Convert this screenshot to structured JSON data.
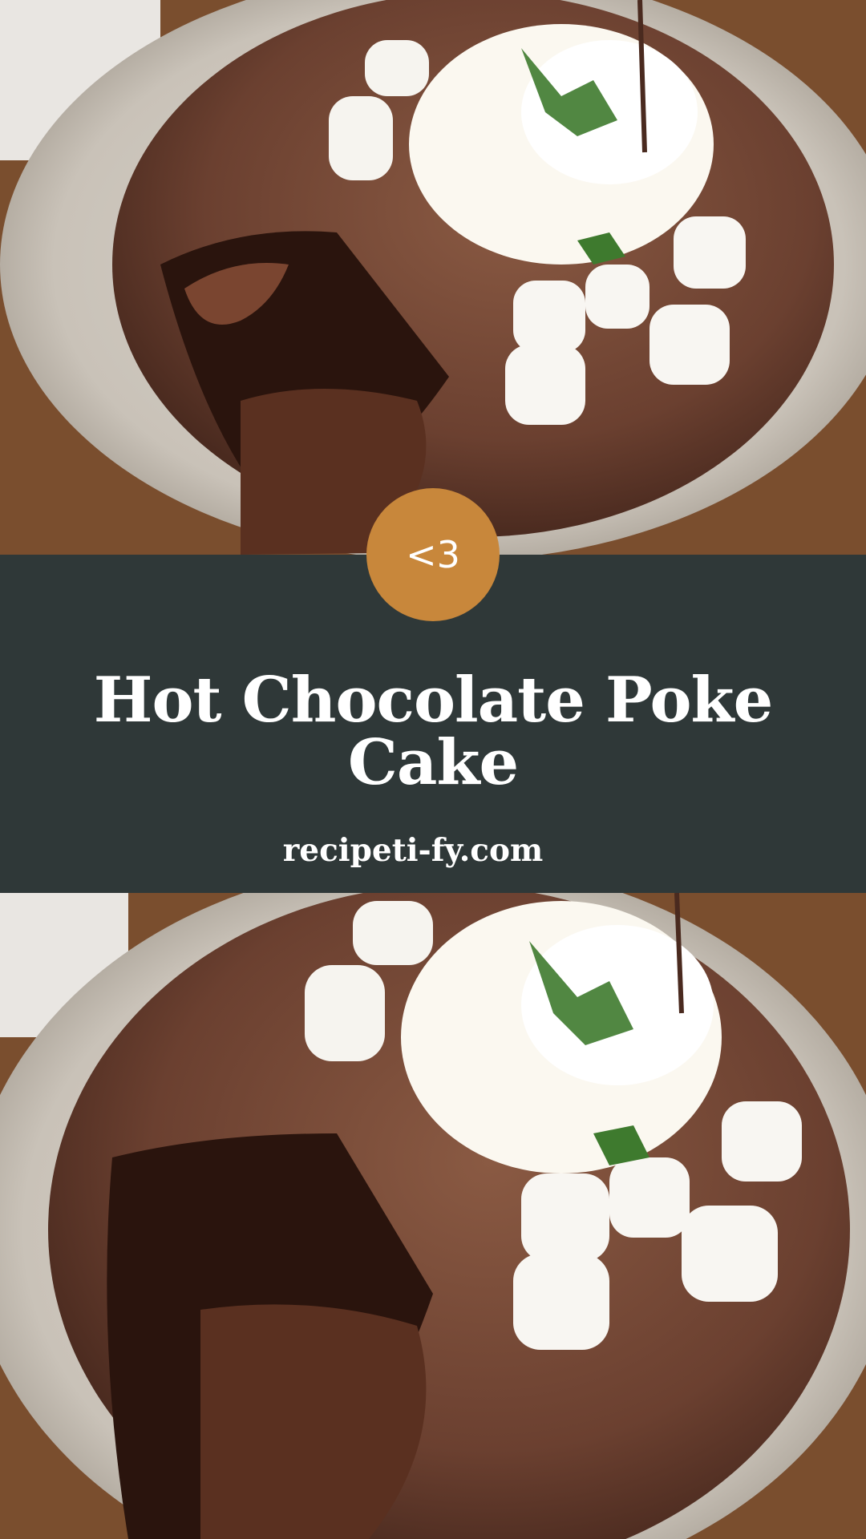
{
  "badge": {
    "text": "<3"
  },
  "title": "Hot Chocolate Poke Cake",
  "site": "recipeti-fy.com",
  "photos": [
    {
      "subject": "chocolate-lava-cake-with-whipped-cream-marshmallows"
    },
    {
      "subject": "chocolate-lava-cake-with-whipped-cream-marshmallows"
    }
  ],
  "colors": {
    "band": "#2f3838",
    "badge": "#c8873b",
    "text": "#ffffff"
  }
}
